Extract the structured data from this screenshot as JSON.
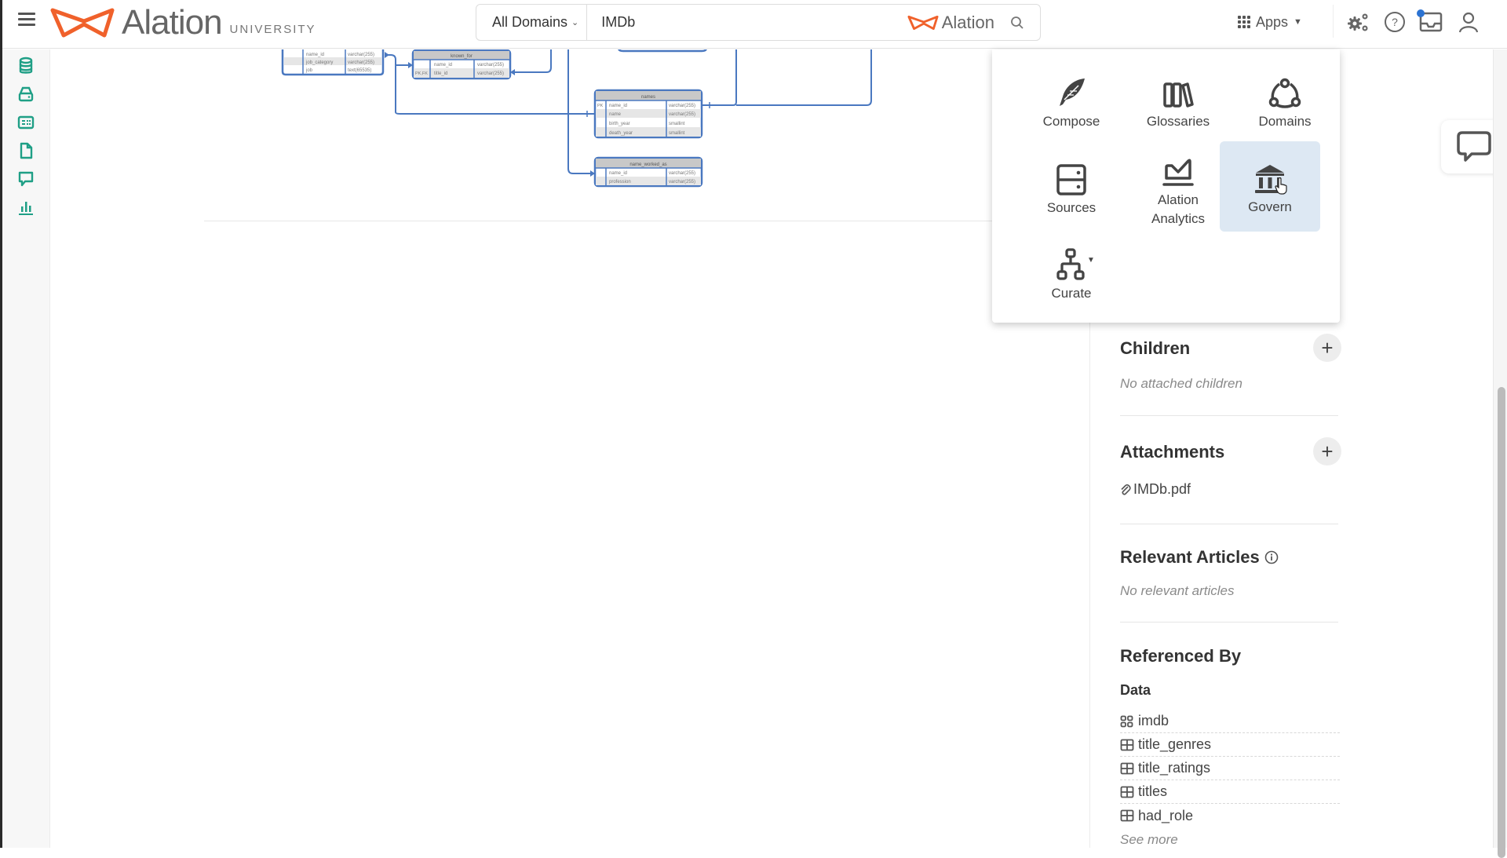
{
  "colors": {
    "brand_orange": "#f0612b",
    "accent_teal": "#1f9f86",
    "erd_blue": "#4a78c0",
    "notification_blue": "#2c73d2",
    "hover_tile": "#dde8f3"
  },
  "header": {
    "menu_icon": "hamburger-icon",
    "logo_text": "Alation",
    "logo_subtext": "UNIVERSITY",
    "search": {
      "domain_select": "All Domains",
      "query": "IMDb",
      "brand_text": "Alation",
      "search_icon": "search-icon"
    },
    "apps_label": "Apps",
    "icons": [
      "settings-gears-icon",
      "help-icon",
      "inbox-icon",
      "user-icon"
    ],
    "inbox_has_notification": true
  },
  "left_rail": {
    "items": [
      {
        "icon": "database-icon"
      },
      {
        "icon": "source-drive-icon"
      },
      {
        "icon": "catalog-card-icon"
      },
      {
        "icon": "document-icon"
      },
      {
        "icon": "conversation-icon"
      },
      {
        "icon": "analytics-bar-icon"
      }
    ]
  },
  "apps_menu": {
    "items": [
      {
        "label": "Compose",
        "icon": "feather-icon"
      },
      {
        "label": "Glossaries",
        "icon": "books-icon"
      },
      {
        "label": "Domains",
        "icon": "domains-network-icon"
      },
      {
        "label": "Sources",
        "icon": "server-icon"
      },
      {
        "label": "Alation Analytics",
        "icon": "area-chart-icon"
      },
      {
        "label": "Govern",
        "icon": "bank-building-icon",
        "hovered": true
      },
      {
        "label": "Curate",
        "icon": "hierarchy-icon",
        "has_dropdown": true
      }
    ]
  },
  "erd": {
    "tables": [
      {
        "name": "",
        "rows": [
          [
            "",
            "name_id",
            "varchar(255)"
          ],
          [
            "",
            "job_category",
            "varchar(255)"
          ],
          [
            "",
            "job",
            "text(65535)"
          ]
        ]
      },
      {
        "name": "known_for",
        "rows": [
          [
            "",
            "name_id",
            "varchar(255)"
          ],
          [
            "PK,FK",
            "title_id",
            "varchar(255)"
          ]
        ]
      },
      {
        "name": "names",
        "rows": [
          [
            "PK",
            "name_id",
            "varchar(255)"
          ],
          [
            "",
            "name",
            "varchar(255)"
          ],
          [
            "",
            "birth_year",
            "smallint"
          ],
          [
            "",
            "death_year",
            "smallint"
          ]
        ]
      },
      {
        "name": "name_worked_as",
        "rows": [
          [
            "",
            "name_id",
            "varchar(255)"
          ],
          [
            "",
            "profession",
            "varchar(255)"
          ]
        ]
      }
    ]
  },
  "right_panel": {
    "children": {
      "title": "Children",
      "empty": "No attached children"
    },
    "attachments": {
      "title": "Attachments",
      "files": [
        "IMDb.pdf"
      ]
    },
    "relevant_articles": {
      "title": "Relevant Articles",
      "empty": "No relevant articles"
    },
    "referenced_by": {
      "title": "Referenced By",
      "subtitle": "Data",
      "items": [
        {
          "label": "imdb",
          "icon": "schema-icon"
        },
        {
          "label": "title_genres",
          "icon": "table-icon"
        },
        {
          "label": "title_ratings",
          "icon": "table-icon"
        },
        {
          "label": "titles",
          "icon": "table-icon"
        },
        {
          "label": "had_role",
          "icon": "table-icon"
        }
      ],
      "see_more": "See more"
    }
  },
  "chat": {
    "icon": "chat-bubble-icon"
  }
}
